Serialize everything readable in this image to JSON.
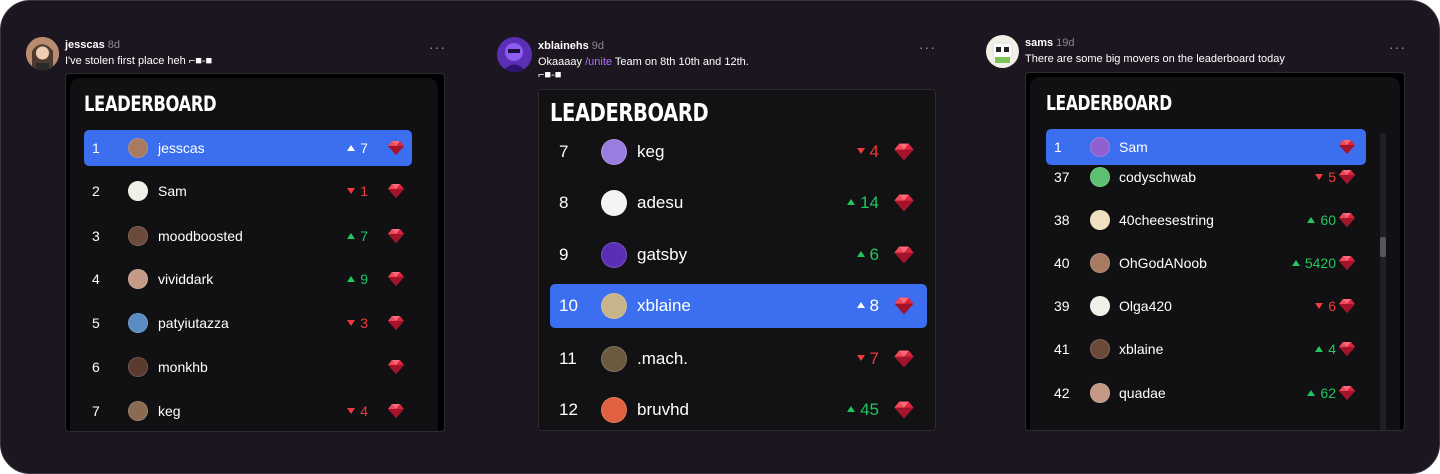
{
  "posts": [
    {
      "username": "jesscas",
      "time": "8d",
      "text": "I've stolen first place heh ⌐■-■",
      "more": "···",
      "leaderboard": {
        "title": "LEADERBOARD",
        "rows": [
          {
            "rank": "1",
            "name": "jesscas",
            "dir": "up",
            "delta": "7",
            "highlight": true
          },
          {
            "rank": "2",
            "name": "Sam",
            "dir": "down",
            "delta": "1"
          },
          {
            "rank": "3",
            "name": "moodboosted",
            "dir": "up",
            "delta": "7"
          },
          {
            "rank": "4",
            "name": "vividdark",
            "dir": "up",
            "delta": "9"
          },
          {
            "rank": "5",
            "name": "patyiutazza",
            "dir": "down",
            "delta": "3"
          },
          {
            "rank": "6",
            "name": "monkhb",
            "dir": "",
            "delta": ""
          },
          {
            "rank": "7",
            "name": "keg",
            "dir": "down",
            "delta": "4"
          }
        ]
      }
    },
    {
      "username": "xblainehs",
      "time": "9d",
      "text_before": "Okaaaay ",
      "mention": "/unite",
      "text_after": " Team on 8th 10th and 12th.",
      "text_line2": "⌐■-■",
      "more": "···",
      "leaderboard": {
        "title": "LEADERBOARD",
        "rows": [
          {
            "rank": "7",
            "name": "keg",
            "dir": "down",
            "delta": "4"
          },
          {
            "rank": "8",
            "name": "adesu",
            "dir": "up",
            "delta": "14"
          },
          {
            "rank": "9",
            "name": "gatsby",
            "dir": "up",
            "delta": "6"
          },
          {
            "rank": "10",
            "name": "xblaine",
            "dir": "up",
            "delta": "8",
            "highlight": true
          },
          {
            "rank": "11",
            "name": ".mach.",
            "dir": "down",
            "delta": "7"
          },
          {
            "rank": "12",
            "name": "bruvhd",
            "dir": "up",
            "delta": "45"
          }
        ]
      }
    },
    {
      "username": "sams",
      "time": "19d",
      "text": "There are some big movers on the leaderboard today",
      "more": "···",
      "leaderboard": {
        "title": "LEADERBOARD",
        "rows": [
          {
            "rank": "1",
            "name": "Sam",
            "dir": "",
            "delta": "",
            "highlight": true
          },
          {
            "rank": "37",
            "name": "codyschwab",
            "dir": "down",
            "delta": "5"
          },
          {
            "rank": "38",
            "name": "40cheesestring",
            "dir": "up",
            "delta": "60"
          },
          {
            "rank": "40",
            "name": "OhGodANoob",
            "dir": "up",
            "delta": "5420"
          },
          {
            "rank": "39",
            "name": "Olga420",
            "dir": "down",
            "delta": "6"
          },
          {
            "rank": "41",
            "name": "xblaine",
            "dir": "up",
            "delta": "4"
          },
          {
            "rank": "42",
            "name": "quadae",
            "dir": "up",
            "delta": "62"
          }
        ]
      }
    }
  ],
  "colors": {
    "highlight": "#3b6ff0",
    "up": "#22c55e",
    "down": "#ef3b3b",
    "mention": "#b36bff",
    "background": "#1b1620"
  }
}
